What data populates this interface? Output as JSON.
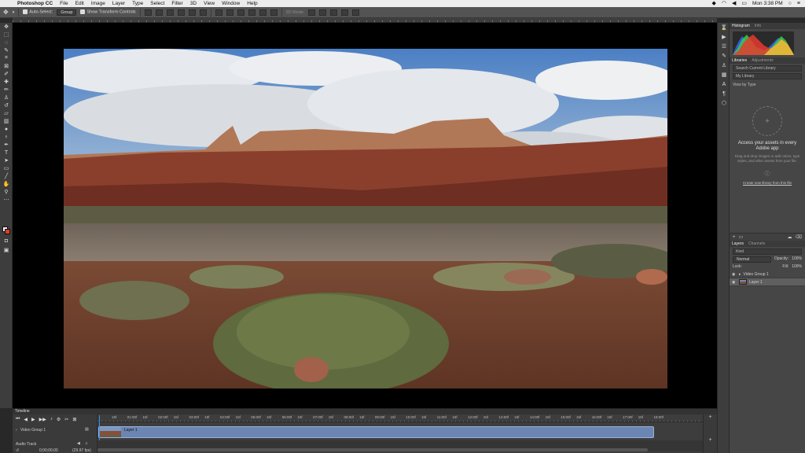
{
  "menubar": {
    "app_name": "Photoshop CC",
    "items": [
      "File",
      "Edit",
      "Image",
      "Layer",
      "Type",
      "Select",
      "Filter",
      "3D",
      "View",
      "Window",
      "Help"
    ],
    "clock": "Mon 3:38 PM"
  },
  "options": {
    "auto_select": "Auto-Select:",
    "auto_select_value": "Group",
    "transform_controls": "Show Transform Controls",
    "mode_3d": "3D Mode:"
  },
  "panels": {
    "histogram_tab": "Histogram",
    "info_tab": "Info",
    "libraries_tab": "Libraries",
    "adjustments_tab": "Adjustments",
    "search_placeholder": "Search Current Library",
    "library_name": "My Library",
    "view_by": "View by Type",
    "lib_title_line1": "Access your assets in every",
    "lib_title_line2": "Adobe app",
    "lib_desc": "Drag and drop images or add colors, type styles, and other assets from your file.",
    "lib_link": "Create new library from this file",
    "layers_tab": "Layers",
    "channels_tab": "Channels",
    "kind": "Kind",
    "blend_mode": "Normal",
    "opacity_label": "Opacity:",
    "opacity_value": "100%",
    "lock_label": "Lock:",
    "fill_label": "Fill:",
    "fill_value": "100%",
    "layers": [
      {
        "name": "Video Group 1"
      },
      {
        "name": "Layer 1"
      }
    ]
  },
  "timeline": {
    "title": "Timeline",
    "track_name": "Video Group 1",
    "audio_track": "Audio Track",
    "timecode": "0;00;00;00",
    "fps": "(29.97 fps)",
    "clip_name": "Layer 1",
    "ruler": [
      "15f",
      "01:00f",
      "15f",
      "02:00f",
      "15f",
      "03:00f",
      "15f",
      "04:00f",
      "15f",
      "05:00f",
      "15f",
      "06:00f",
      "15f",
      "07:00f",
      "15f",
      "08:00f",
      "15f",
      "09:00f",
      "15f",
      "10:00f",
      "15f",
      "11:00f",
      "15f",
      "12:00f",
      "15f",
      "13:00f",
      "15f",
      "14:00f",
      "15f",
      "15:00f",
      "15f",
      "16:00f",
      "15f",
      "17:00f",
      "15f",
      "18:00f"
    ]
  }
}
